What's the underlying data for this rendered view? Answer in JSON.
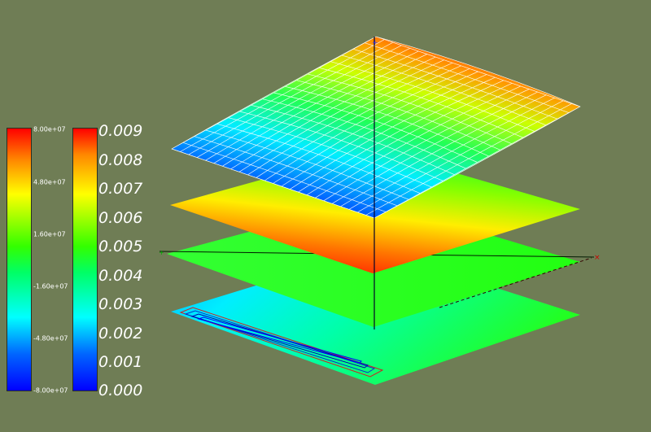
{
  "legend_stress": {
    "title": "",
    "ticks": [
      "8.00e+07",
      "4.80e+07",
      "1.60e+07",
      "-1.60e+07",
      "-4.80e+07",
      "-8.00e+07"
    ],
    "range": [
      -80000000,
      80000000
    ]
  },
  "legend_displacement": {
    "title": "",
    "ticks": [
      "0.009",
      "0.008",
      "0.007",
      "0.006",
      "0.005",
      "0.004",
      "0.003",
      "0.002",
      "0.001",
      "0.000"
    ],
    "range": [
      0,
      0.009
    ]
  },
  "axis_labels": {
    "y_axis_text_1": "",
    "y_axis_text_2": "",
    "x_axis_text": ""
  },
  "colors": {
    "background": "#6f7d55",
    "mesh_line": "#ffffff",
    "axis_line": "#000030",
    "outline": "#cc0000"
  }
}
